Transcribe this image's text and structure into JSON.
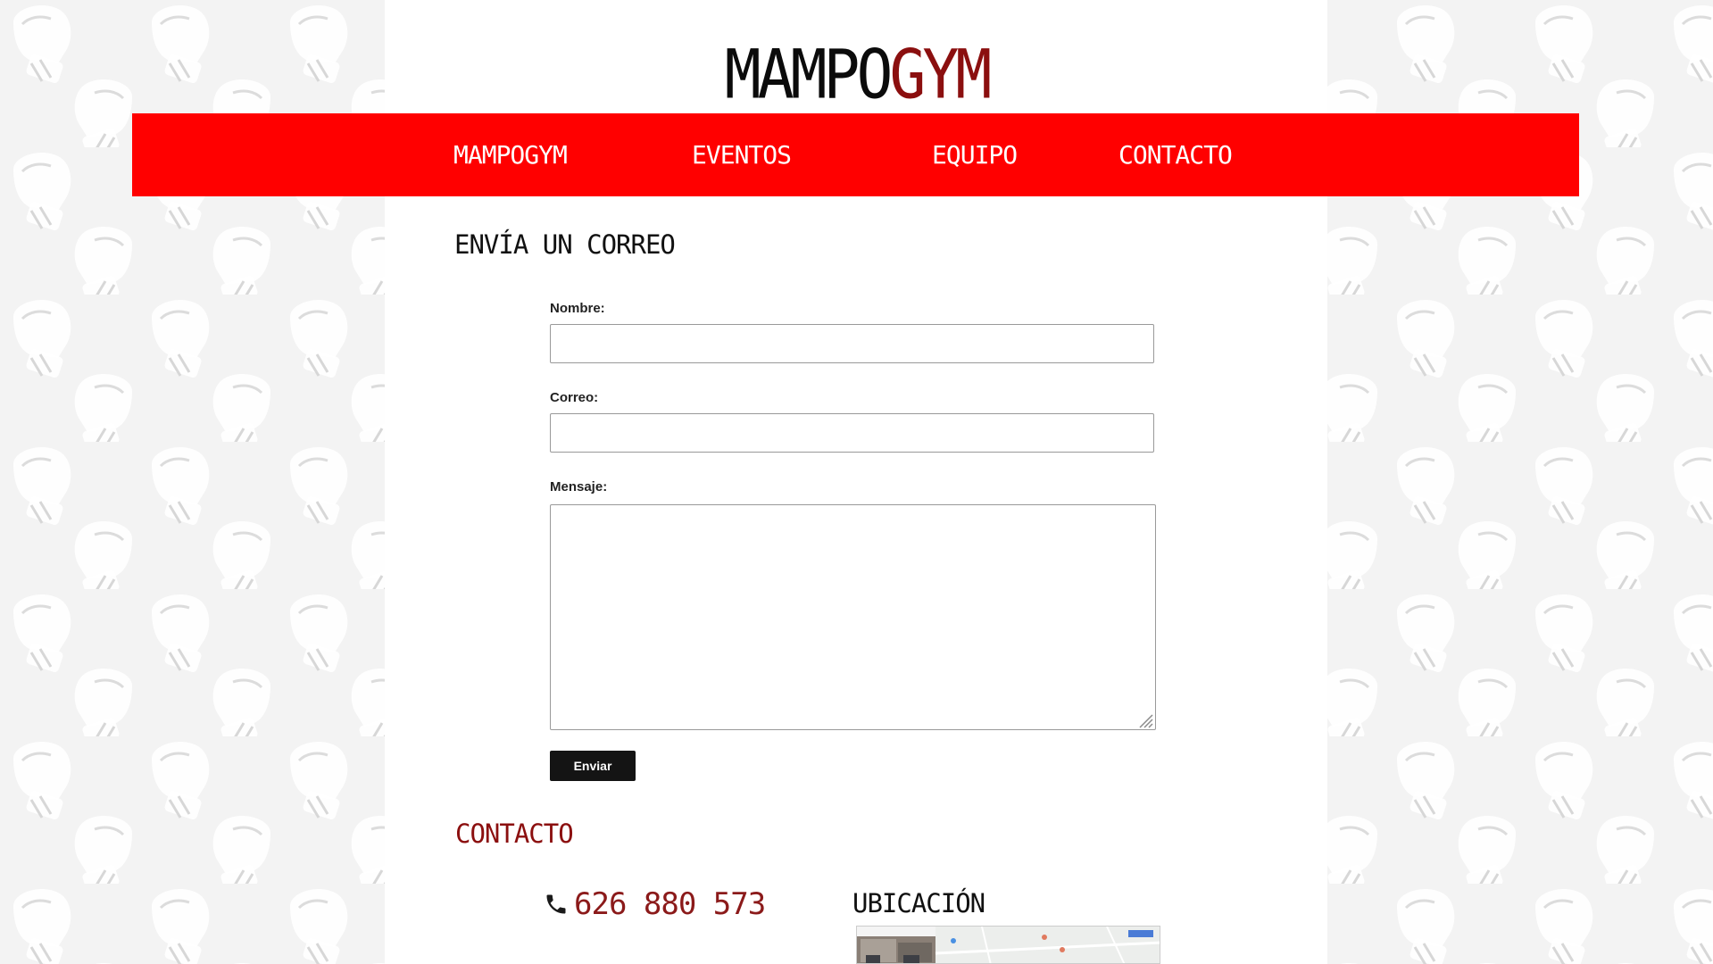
{
  "site": {
    "logo_part1": "MAMPO",
    "logo_part2": "GYM"
  },
  "nav": {
    "items": [
      {
        "label": "MAMPOGYM"
      },
      {
        "label": "EVENTOS"
      },
      {
        "label": "EQUIPO"
      },
      {
        "label": "CONTACTO"
      }
    ]
  },
  "form": {
    "heading": "ENVÍA UN CORREO",
    "name_label": "Nombre:",
    "name_value": "",
    "email_label": "Correo:",
    "email_value": "",
    "message_label": "Mensaje:",
    "message_value": "",
    "submit_label": "Enviar"
  },
  "contact": {
    "heading": "CONTACTO",
    "phone": "626 880 573",
    "location_heading": "UBICACIÓN",
    "phone_icon": "phone-icon",
    "map": "map-thumbnail"
  },
  "colors": {
    "nav_red": "#ff0000",
    "brand_dark_red": "#8b0f0f",
    "button_black": "#141414"
  },
  "icons": [
    "boxing-glove-icon",
    "phone-icon",
    "resize-grip-icon"
  ]
}
